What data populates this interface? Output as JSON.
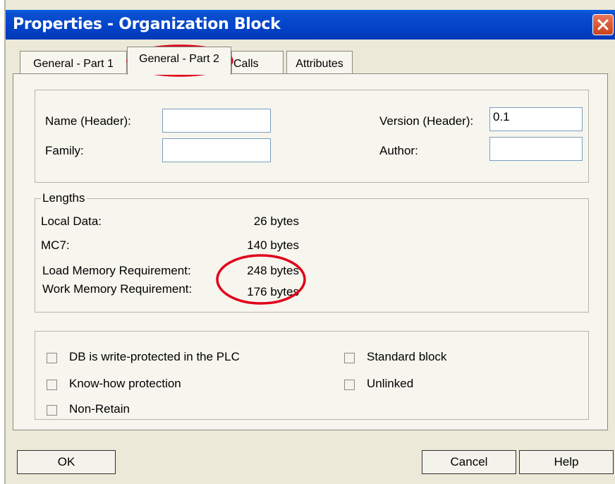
{
  "window": {
    "title": "Properties - Organization Block"
  },
  "tabs": [
    "General - Part 1",
    "General - Part 2",
    "Calls",
    "Attributes"
  ],
  "header_fields": {
    "name_label": "Name (Header):",
    "name_value": "",
    "family_label": "Family:",
    "family_value": "",
    "version_label": "Version (Header):",
    "version_value": "0.1",
    "author_label": "Author:",
    "author_value": ""
  },
  "lengths": {
    "group_label": "Lengths",
    "rows": [
      {
        "label": "Local Data:",
        "value": "26 bytes"
      },
      {
        "label": "MC7:",
        "value": "140 bytes"
      },
      {
        "label": "Load Memory Requirement:",
        "value": "248 bytes"
      },
      {
        "label": "Work Memory Requirement:",
        "value": "176 bytes"
      }
    ]
  },
  "options": {
    "write_protected": {
      "label": "DB is write-protected in the PLC",
      "checked": false
    },
    "know_how": {
      "label": "Know-how protection",
      "checked": false
    },
    "non_retain": {
      "label": "Non-Retain",
      "checked": false
    },
    "standard_block": {
      "label": "Standard block",
      "checked": false
    },
    "unlinked": {
      "label": "Unlinked",
      "checked": false
    }
  },
  "buttons": {
    "ok": "OK",
    "cancel": "Cancel",
    "help": "Help"
  },
  "colors": {
    "titlebar": "#0343c8",
    "dialog_bg": "#ece9d8",
    "annotation": "#e0001a"
  }
}
